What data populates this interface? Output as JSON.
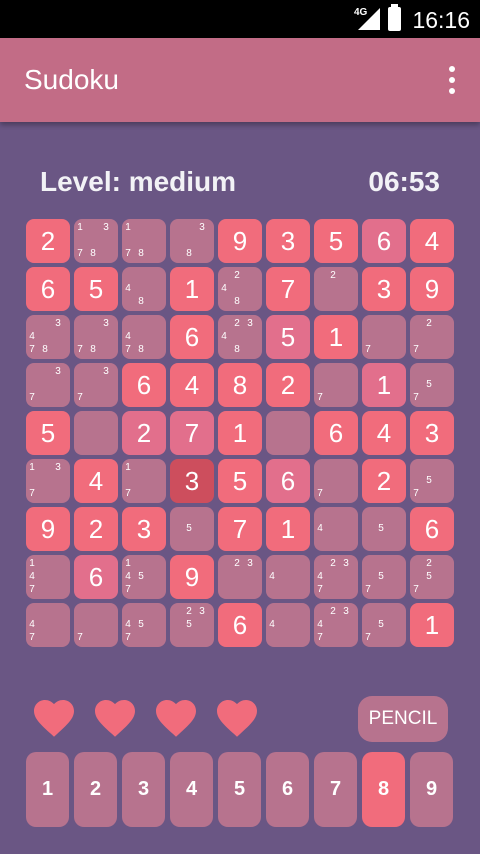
{
  "status_bar": {
    "network": "4G",
    "time": "16:16"
  },
  "app_bar": {
    "title": "Sudoku",
    "menu_icon": "more-vert-icon"
  },
  "game": {
    "level": "Level: medium",
    "timer": "06:53"
  },
  "board": [
    [
      {
        "v": "2",
        "t": "g"
      },
      {
        "n": [
          "1",
          "3",
          "7",
          "8"
        ]
      },
      {
        "n": [
          "1",
          "7",
          "8"
        ]
      },
      {
        "n": [
          "3",
          "8"
        ]
      },
      {
        "v": "9",
        "t": "g"
      },
      {
        "v": "3",
        "t": "g"
      },
      {
        "v": "5",
        "t": "g"
      },
      {
        "v": "6",
        "t": "r"
      },
      {
        "v": "4",
        "t": "g"
      }
    ],
    [
      {
        "v": "6",
        "t": "g"
      },
      {
        "v": "5",
        "t": "g"
      },
      {
        "n": [
          "4",
          "8"
        ]
      },
      {
        "v": "1",
        "t": "g"
      },
      {
        "n": [
          "2",
          "4",
          "8"
        ]
      },
      {
        "v": "7",
        "t": "g"
      },
      {
        "n": [
          "2"
        ]
      },
      {
        "v": "3",
        "t": "g"
      },
      {
        "v": "9",
        "t": "g"
      }
    ],
    [
      {
        "n": [
          "3",
          "4",
          "7",
          "8"
        ]
      },
      {
        "n": [
          "3",
          "7",
          "8"
        ]
      },
      {
        "n": [
          "4",
          "7",
          "8"
        ]
      },
      {
        "v": "6",
        "t": "g"
      },
      {
        "n": [
          "2",
          "3",
          "4",
          "8"
        ]
      },
      {
        "v": "5",
        "t": "r"
      },
      {
        "v": "1",
        "t": "g"
      },
      {
        "n": [
          "7"
        ]
      },
      {
        "n": [
          "2",
          "7"
        ]
      }
    ],
    [
      {
        "n": [
          "3",
          "7"
        ]
      },
      {
        "n": [
          "3",
          "7"
        ]
      },
      {
        "v": "6",
        "t": "g"
      },
      {
        "v": "4",
        "t": "g"
      },
      {
        "v": "8",
        "t": "g"
      },
      {
        "v": "2",
        "t": "g"
      },
      {
        "n": [
          "7"
        ]
      },
      {
        "v": "1",
        "t": "r"
      },
      {
        "n": [
          "5",
          "7"
        ]
      }
    ],
    [
      {
        "v": "5",
        "t": "g"
      },
      {
        "n": []
      },
      {
        "v": "2",
        "t": "r"
      },
      {
        "v": "7",
        "t": "r"
      },
      {
        "v": "1",
        "t": "g"
      },
      {
        "n": []
      },
      {
        "v": "6",
        "t": "g"
      },
      {
        "v": "4",
        "t": "g"
      },
      {
        "v": "3",
        "t": "g"
      }
    ],
    [
      {
        "n": [
          "1",
          "3",
          "7"
        ]
      },
      {
        "v": "4",
        "t": "g"
      },
      {
        "n": [
          "1",
          "7"
        ]
      },
      {
        "v": "3",
        "t": "s"
      },
      {
        "v": "5",
        "t": "g"
      },
      {
        "v": "6",
        "t": "r"
      },
      {
        "n": [
          "7"
        ]
      },
      {
        "v": "2",
        "t": "g"
      },
      {
        "n": [
          "5",
          "7"
        ]
      }
    ],
    [
      {
        "v": "9",
        "t": "g"
      },
      {
        "v": "2",
        "t": "g"
      },
      {
        "v": "3",
        "t": "g"
      },
      {
        "n": [
          "5"
        ]
      },
      {
        "v": "7",
        "t": "g"
      },
      {
        "v": "1",
        "t": "g"
      },
      {
        "n": [
          "4"
        ]
      },
      {
        "n": [
          "5"
        ]
      },
      {
        "v": "6",
        "t": "g"
      }
    ],
    [
      {
        "n": [
          "1",
          "4",
          "7"
        ]
      },
      {
        "v": "6",
        "t": "r"
      },
      {
        "n": [
          "1",
          "4",
          "5",
          "7"
        ]
      },
      {
        "v": "9",
        "t": "g"
      },
      {
        "n": [
          "2",
          "3"
        ]
      },
      {
        "n": [
          "4"
        ]
      },
      {
        "n": [
          "2",
          "3",
          "4",
          "7"
        ]
      },
      {
        "n": [
          "5",
          "7"
        ]
      },
      {
        "n": [
          "2",
          "5",
          "7"
        ]
      }
    ],
    [
      {
        "n": [
          "4",
          "7"
        ]
      },
      {
        "n": [
          "7"
        ]
      },
      {
        "n": [
          "4",
          "5",
          "7"
        ]
      },
      {
        "n": [
          "2",
          "3",
          "5"
        ]
      },
      {
        "v": "6",
        "t": "g"
      },
      {
        "n": [
          "4"
        ]
      },
      {
        "n": [
          "2",
          "3",
          "4",
          "7"
        ]
      },
      {
        "n": [
          "5",
          "7"
        ]
      },
      {
        "v": "1",
        "t": "g"
      }
    ]
  ],
  "lives": {
    "count": 4,
    "icon": "heart-icon",
    "color": "#f16c7c"
  },
  "pencil_label": "PENCIL",
  "numpad": {
    "keys": [
      "1",
      "2",
      "3",
      "4",
      "5",
      "6",
      "7",
      "8",
      "9"
    ],
    "active": "8"
  },
  "colors": {
    "background": "#6a5684",
    "app_bar": "#c26c86",
    "cell_empty": "#b7738e",
    "cell_given": "#f16c7c",
    "cell_selected": "#cd4e5d"
  }
}
